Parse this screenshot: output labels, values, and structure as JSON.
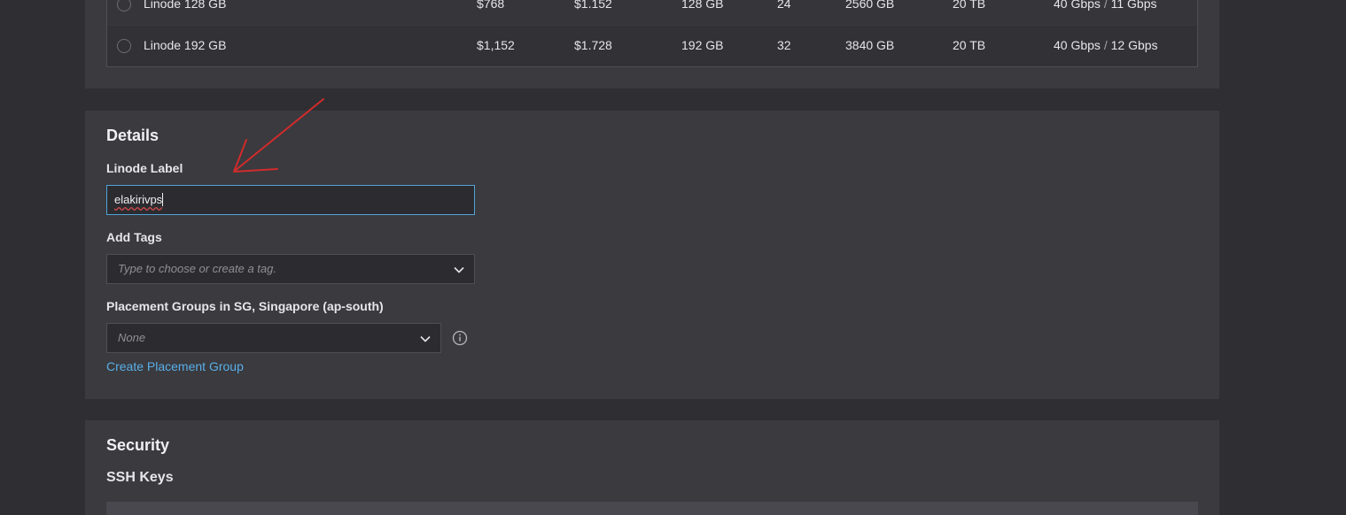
{
  "plans": {
    "rows": [
      {
        "name": "Linode 128 GB",
        "monthly": "$768",
        "hourly": "$1.152",
        "ram": "128 GB",
        "cpus": "24",
        "storage": "2560 GB",
        "transfer": "20 TB",
        "network_in": "40 Gbps",
        "network_sep": "/",
        "network_out": "11 Gbps"
      },
      {
        "name": "Linode 192 GB",
        "monthly": "$1,152",
        "hourly": "$1.728",
        "ram": "192 GB",
        "cpus": "32",
        "storage": "3840 GB",
        "transfer": "20 TB",
        "network_in": "40 Gbps",
        "network_sep": "/",
        "network_out": "12 Gbps"
      }
    ]
  },
  "details": {
    "title": "Details",
    "linode_label": {
      "label": "Linode Label",
      "value": "elakirivps"
    },
    "tags": {
      "label": "Add Tags",
      "placeholder": "Type to choose or create a tag."
    },
    "placement": {
      "label": "Placement Groups in SG, Singapore (ap-south)",
      "value": "None",
      "create_link": "Create Placement Group"
    }
  },
  "security": {
    "title": "Security",
    "ssh_keys_label": "SSH Keys"
  },
  "colors": {
    "background": "#2f2f33",
    "panel": "#3a3a3f",
    "link": "#5aaee6",
    "focus": "#52a2d6",
    "annotation": "#d12b2b"
  },
  "icons": {
    "chevron": "chevron-down-icon",
    "info": "info-icon",
    "radio": "radio-button"
  }
}
